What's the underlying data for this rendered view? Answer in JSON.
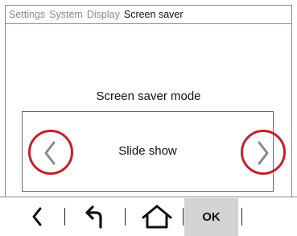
{
  "breadcrumb": [
    "Settings",
    "System",
    "Display",
    "Screen saver"
  ],
  "setting": {
    "title": "Screen saver mode",
    "value": "Slide show"
  },
  "toolbar": {
    "ok_label": "OK"
  },
  "icons": {
    "prev": "chevron-left-icon",
    "next": "chevron-right-icon",
    "back": "back-arrow-icon",
    "undo": "undo-icon",
    "home": "home-icon"
  },
  "colors": {
    "highlight_ring": "#c5202a",
    "ok_background": "#d4d4d4",
    "inactive_crumb": "#8a8a8a"
  }
}
